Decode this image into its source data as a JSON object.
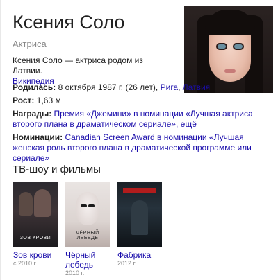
{
  "header": {
    "name": "Ксения Соло",
    "subtitle": "Актриса"
  },
  "description": {
    "text": "Ксения Соло — актриса родом из Латвии.",
    "source_link": "Википедия"
  },
  "facts": {
    "born": {
      "label": "Родилась:",
      "value": "8 октября 1987 г. (26 лет),",
      "city_link": "Рига",
      "separator": ",",
      "country_link": "Латвия"
    },
    "height": {
      "label": "Рост:",
      "value": "1,63 м"
    },
    "awards": {
      "label": "Награды:",
      "link": "Премия «Джемини» в номинации «Лучшая актриса второго плана в драматическом сериале»",
      "more": ", ещё"
    },
    "nominations": {
      "label": "Номинации:",
      "link": "Canadian Screen Award в номинации «Лучшая женская роль второго плана в драматической программе или сериале»"
    }
  },
  "tv_section": {
    "title": "ТВ-шоу и фильмы",
    "items": [
      {
        "title": "Зов крови",
        "year": "с 2010 г.",
        "poster_text": "ЗОВ КРОВИ"
      },
      {
        "title": "Чёрный лебедь",
        "year": "2010 г.",
        "poster_text": "ЧЁРНЫЙ ЛЕБЕДЬ"
      },
      {
        "title": "Фабрика",
        "year": "2012 г.",
        "poster_text": ""
      }
    ]
  },
  "colors": {
    "link": "#1a0dab",
    "muted": "#878787",
    "text": "#222222"
  }
}
